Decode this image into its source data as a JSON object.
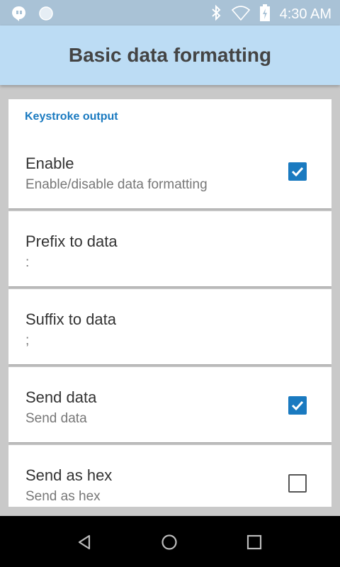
{
  "status_bar": {
    "time": "4:30 AM",
    "icons": [
      "hangouts-icon",
      "circle-notification-icon",
      "bluetooth-icon",
      "wifi-icon",
      "battery-charging-icon"
    ]
  },
  "app_bar": {
    "title": "Basic data formatting"
  },
  "section": {
    "header": "Keystroke output"
  },
  "preferences": [
    {
      "title": "Enable",
      "summary": "Enable/disable data formatting",
      "checkbox": "checked"
    },
    {
      "title": "Prefix to data",
      "summary": ":"
    },
    {
      "title": "Suffix to data",
      "summary": ";"
    },
    {
      "title": "Send data",
      "summary": "Send data",
      "checkbox": "checked"
    },
    {
      "title": "Send as hex",
      "summary": "Send as hex",
      "checkbox": "unchecked"
    }
  ],
  "nav_bar": {
    "buttons": [
      "back-icon",
      "home-icon",
      "recents-icon"
    ]
  },
  "colors": {
    "accent": "#1a7ac0",
    "app_bar": "#bcdcf4",
    "status_bar": "#a9c2d6"
  }
}
